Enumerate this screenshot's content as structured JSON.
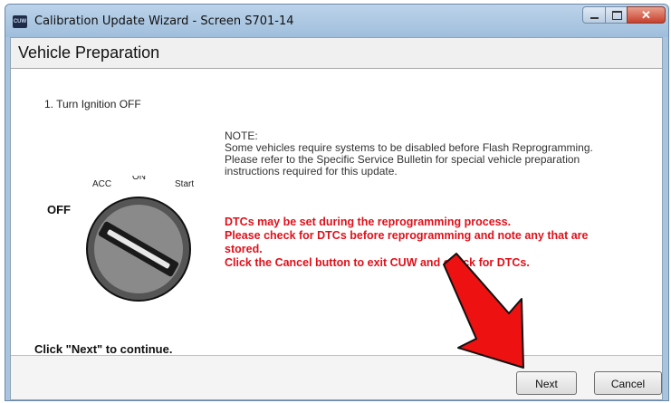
{
  "window": {
    "title": "Calibration Update Wizard - Screen S701-14",
    "app_icon_text": "CUW"
  },
  "header": {
    "title": "Vehicle Preparation"
  },
  "content": {
    "step": "1. Turn Ignition OFF",
    "ignition_labels": {
      "acc": "ACC",
      "on": "ON",
      "start": "Start",
      "off": "OFF"
    },
    "note": {
      "heading": "NOTE:",
      "line1": "Some vehicles require systems to be disabled before Flash Reprogramming.",
      "line2": "Please refer to the Specific Service Bulletin for special vehicle preparation",
      "line3": "instructions required for this update."
    },
    "warning": {
      "line1": "DTCs may be set during the reprogramming process.",
      "line2": "Please check for DTCs before reprogramming and note any that are",
      "line3": "stored.",
      "line4": "Click the Cancel button to exit CUW and check for DTCs."
    },
    "continue_text": "Click \"Next\" to continue."
  },
  "buttons": {
    "next": "Next",
    "cancel": "Cancel"
  },
  "colors": {
    "warning": "#e0101a",
    "arrow": "#ee1111"
  }
}
